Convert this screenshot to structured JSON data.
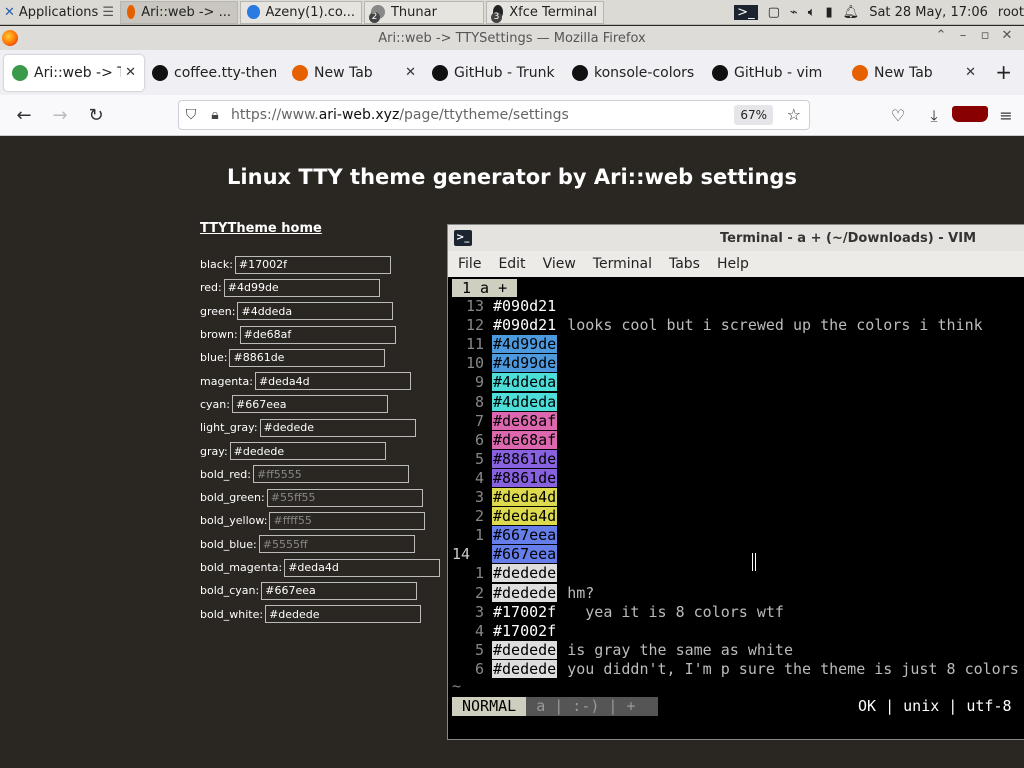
{
  "panel": {
    "applications_label": "Applications",
    "tasks": [
      {
        "label": "Ari::web -> ...",
        "color": "#e66000"
      },
      {
        "label": "Azeny(1).co...",
        "color": "#2a7ae2"
      },
      {
        "label": "Thunar",
        "badge": "2",
        "color": "#888"
      },
      {
        "label": "Xfce Terminal",
        "badge": "3",
        "color": "#222"
      }
    ],
    "clock": "Sat 28 May, 17:06",
    "user": "root"
  },
  "window_title": "Ari::web -> TTYSettings — Mozilla Firefox",
  "tabs": [
    {
      "label": "Ari::web -> TTYSettings",
      "favicon_color": "#3a9a4a",
      "active": true
    },
    {
      "label": "coffee.tty-themes",
      "favicon_color": "#111"
    },
    {
      "label": "New Tab",
      "favicon_color": "#e66000"
    },
    {
      "label": "GitHub - Trunk",
      "favicon_color": "#111"
    },
    {
      "label": "konsole-colors",
      "favicon_color": "#111"
    },
    {
      "label": "GitHub - vim",
      "favicon_color": "#111"
    },
    {
      "label": "New Tab",
      "favicon_color": "#e66000"
    }
  ],
  "url": {
    "prefix": "https://www.",
    "domain": "ari-web.xyz",
    "path": "/page/ttytheme/settings",
    "zoom": "67%"
  },
  "page": {
    "heading": "Linux TTY theme generator by Ari::web settings",
    "home_link": "TTYTheme home",
    "settings": [
      {
        "label": "black:",
        "value": "#17002f",
        "placeholder": ""
      },
      {
        "label": "red:",
        "value": "#4d99de",
        "placeholder": ""
      },
      {
        "label": "green:",
        "value": "#4ddeda",
        "placeholder": ""
      },
      {
        "label": "brown:",
        "value": "#de68af",
        "placeholder": ""
      },
      {
        "label": "blue:",
        "value": "#8861de",
        "placeholder": ""
      },
      {
        "label": "magenta:",
        "value": "#deda4d",
        "placeholder": ""
      },
      {
        "label": "cyan:",
        "value": "#667eea",
        "placeholder": ""
      },
      {
        "label": "light_gray:",
        "value": "#dedede",
        "placeholder": ""
      },
      {
        "label": "gray:",
        "value": "#dedede",
        "placeholder": ""
      },
      {
        "label": "bold_red:",
        "value": "",
        "placeholder": "#ff5555"
      },
      {
        "label": "bold_green:",
        "value": "",
        "placeholder": "#55ff55"
      },
      {
        "label": "bold_yellow:",
        "value": "",
        "placeholder": "#ffff55"
      },
      {
        "label": "bold_blue:",
        "value": "",
        "placeholder": "#5555ff"
      },
      {
        "label": "bold_magenta:",
        "value": "#deda4d",
        "placeholder": ""
      },
      {
        "label": "bold_cyan:",
        "value": "#667eea",
        "placeholder": ""
      },
      {
        "label": "bold_white:",
        "value": "#dedede",
        "placeholder": ""
      }
    ]
  },
  "terminal": {
    "title": "Terminal - a + (~/Downloads) - VIM",
    "menu": [
      "File",
      "Edit",
      "View",
      "Terminal",
      "Tabs",
      "Help"
    ],
    "vim_tab": "1  a +",
    "lines": [
      {
        "num": "13",
        "hex": "#090d21",
        "bg": "#000000",
        "fg": "#ffffff",
        "comment": ""
      },
      {
        "num": "12",
        "hex": "#090d21",
        "bg": "#000000",
        "fg": "#ffffff",
        "comment": "looks cool but i screwed up the colors i think"
      },
      {
        "num": "11",
        "hex": "#4d99de",
        "bg": "#4d99de",
        "fg": "#000000",
        "comment": ""
      },
      {
        "num": "10",
        "hex": "#4d99de",
        "bg": "#4d99de",
        "fg": "#000000",
        "comment": ""
      },
      {
        "num": "9",
        "hex": "#4ddeda",
        "bg": "#4ddeda",
        "fg": "#000000",
        "comment": ""
      },
      {
        "num": "8",
        "hex": "#4ddeda",
        "bg": "#4ddeda",
        "fg": "#000000",
        "comment": ""
      },
      {
        "num": "7",
        "hex": "#de68af",
        "bg": "#de68af",
        "fg": "#000000",
        "comment": ""
      },
      {
        "num": "6",
        "hex": "#de68af",
        "bg": "#de68af",
        "fg": "#000000",
        "comment": ""
      },
      {
        "num": "5",
        "hex": "#8861de",
        "bg": "#8861de",
        "fg": "#000000",
        "comment": ""
      },
      {
        "num": "4",
        "hex": "#8861de",
        "bg": "#8861de",
        "fg": "#000000",
        "comment": ""
      },
      {
        "num": "3",
        "hex": "#deda4d",
        "bg": "#deda4d",
        "fg": "#000000",
        "comment": ""
      },
      {
        "num": "2",
        "hex": "#deda4d",
        "bg": "#deda4d",
        "fg": "#000000",
        "comment": ""
      },
      {
        "num": "1",
        "hex": "#667eea",
        "bg": "#667eea",
        "fg": "#000000",
        "comment": ""
      },
      {
        "num": "14",
        "hex": "#667eea",
        "bg": "#667eea",
        "fg": "#000000",
        "comment": "",
        "current": true
      },
      {
        "num": "1",
        "hex": "#dedede",
        "bg": "#dedede",
        "fg": "#000000",
        "comment": ""
      },
      {
        "num": "2",
        "hex": "#dedede",
        "bg": "#dedede",
        "fg": "#000000",
        "comment": "hm?"
      },
      {
        "num": "3",
        "hex": "#17002f",
        "bg": "#000000",
        "fg": "#ffffff",
        "comment": "  yea it is 8 colors wtf"
      },
      {
        "num": "4",
        "hex": "#17002f",
        "bg": "#000000",
        "fg": "#ffffff",
        "comment": ""
      },
      {
        "num": "5",
        "hex": "#dedede",
        "bg": "#dedede",
        "fg": "#000000",
        "comment": "is gray the same as white"
      },
      {
        "num": "6",
        "hex": "#dedede",
        "bg": "#dedede",
        "fg": "#000000",
        "comment": "you diddn't, I'm p sure the theme is just 8 colors"
      }
    ],
    "tilde": "~",
    "mode": "NORMAL",
    "status_rest": "a  |  :-)  |  +",
    "status_right": "OK | unix | utf-8"
  }
}
